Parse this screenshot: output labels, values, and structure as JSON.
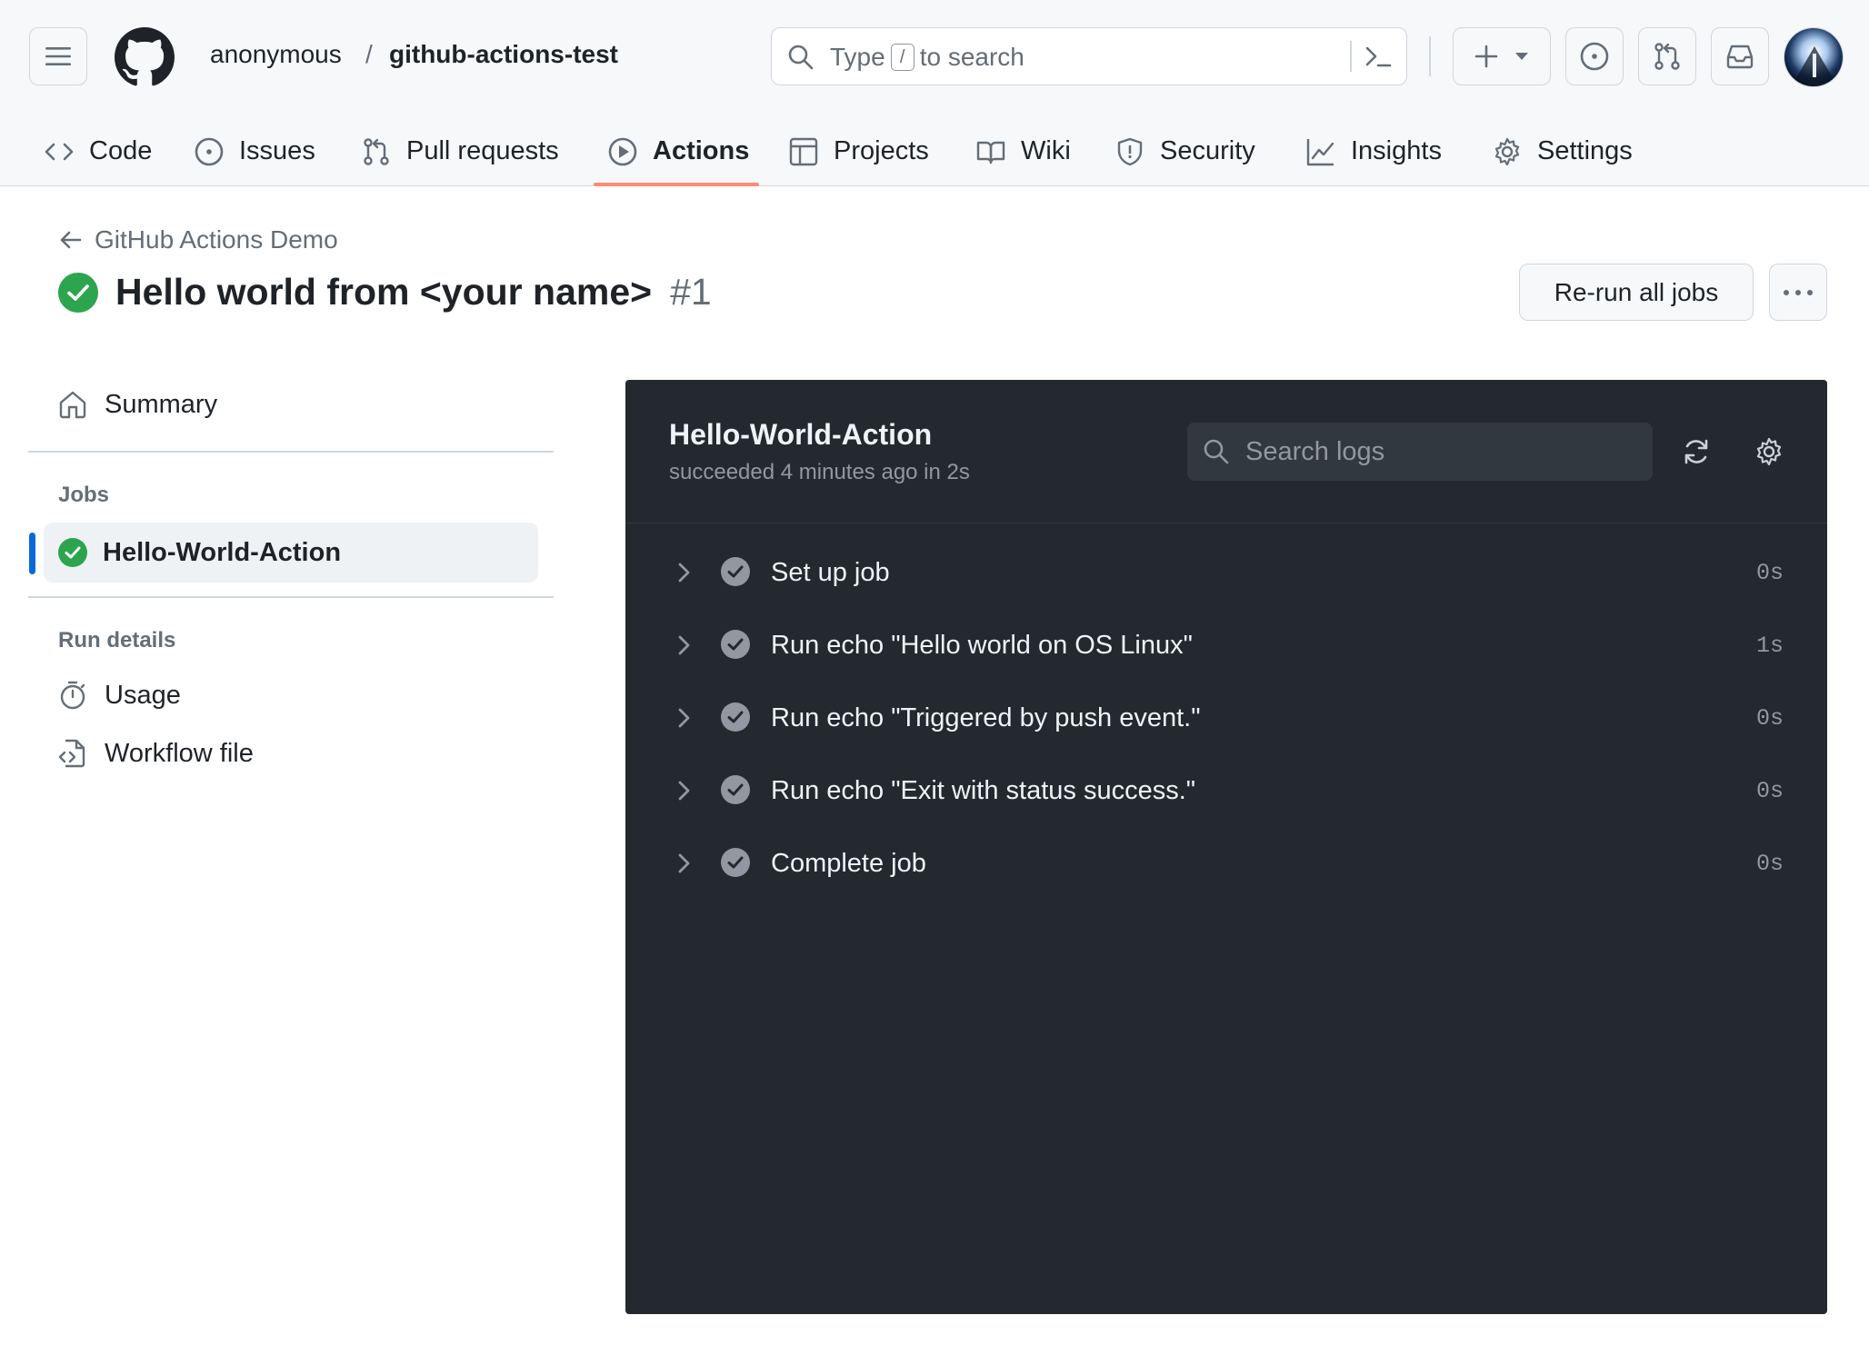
{
  "header": {
    "owner": "anonymous",
    "separator": "/",
    "repo": "github-actions-test",
    "search": {
      "prefix": "Type",
      "key": "/",
      "suffix": "to search"
    }
  },
  "tabs": [
    {
      "label": "Code",
      "icon": "code-icon"
    },
    {
      "label": "Issues",
      "icon": "issue-opened-icon"
    },
    {
      "label": "Pull requests",
      "icon": "git-pull-request-icon"
    },
    {
      "label": "Actions",
      "icon": "play-icon",
      "active": true
    },
    {
      "label": "Projects",
      "icon": "table-icon"
    },
    {
      "label": "Wiki",
      "icon": "book-icon"
    },
    {
      "label": "Security",
      "icon": "shield-icon"
    },
    {
      "label": "Insights",
      "icon": "graph-icon"
    },
    {
      "label": "Settings",
      "icon": "gear-icon"
    }
  ],
  "run": {
    "back_label": "GitHub Actions Demo",
    "title": "Hello world from <your name>",
    "number": "#1",
    "rerun_label": "Re-run all jobs"
  },
  "sidebar": {
    "summary_label": "Summary",
    "jobs_heading": "Jobs",
    "job_label": "Hello-World-Action",
    "details_heading": "Run details",
    "usage_label": "Usage",
    "workflow_label": "Workflow file"
  },
  "log": {
    "job_title": "Hello-World-Action",
    "job_status": "succeeded 4 minutes ago in 2s",
    "search_placeholder": "Search logs",
    "steps": [
      {
        "label": "Set up job",
        "duration": "0s"
      },
      {
        "label": "Run echo \"Hello world on OS Linux\"",
        "duration": "1s"
      },
      {
        "label": "Run echo \"Triggered by push event.\"",
        "duration": "0s"
      },
      {
        "label": "Run echo \"Exit with status success.\"",
        "duration": "0s"
      },
      {
        "label": "Complete job",
        "duration": "0s"
      }
    ]
  },
  "colors": {
    "success_green": "#2da44e",
    "tab_underline": "#fd8c73",
    "panel_bg": "#24292f",
    "active_bar": "#0969da"
  }
}
